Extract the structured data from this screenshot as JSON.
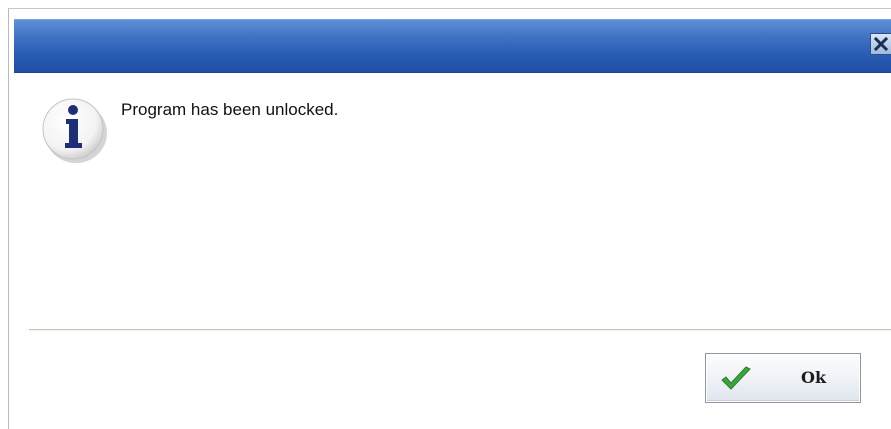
{
  "dialog": {
    "close_icon": "close-icon",
    "info_icon": "information-icon",
    "message": "Program has been unlocked.",
    "ok_button": {
      "label": "Ok",
      "icon": "checkmark-icon"
    }
  },
  "colors": {
    "titlebar": "#2f63b8",
    "info_icon_glyph": "#1e2f7a",
    "checkmark": "#3aa63a"
  }
}
